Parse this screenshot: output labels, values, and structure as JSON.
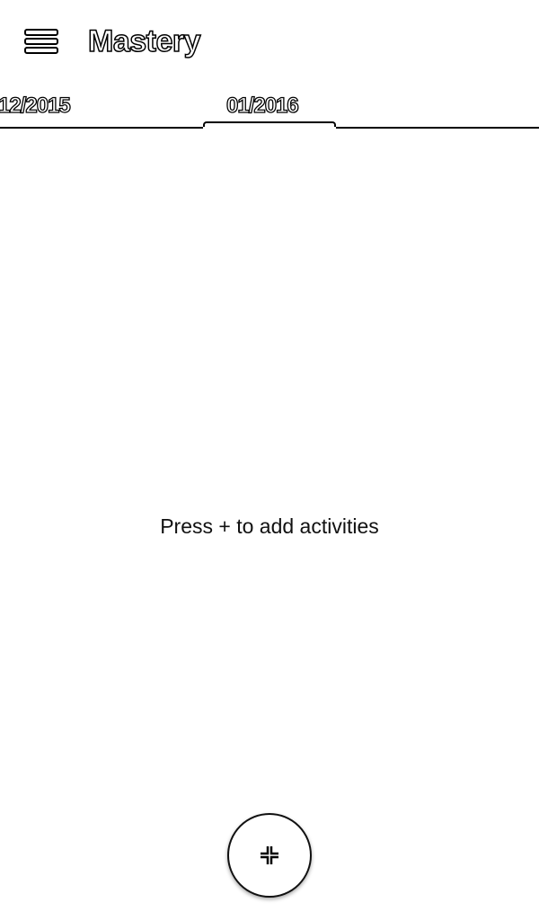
{
  "toolbar": {
    "menu_icon": "hamburger-menu-icon",
    "title": "Mastery"
  },
  "tabs": {
    "items": [
      {
        "label": "12/2015",
        "selected": false
      },
      {
        "label": "01/2016",
        "selected": true
      }
    ]
  },
  "main": {
    "empty_message": "Press + to add activities"
  },
  "fab": {
    "icon": "add-icon"
  },
  "colors": {
    "background": "#ffffff",
    "foreground": "#000000"
  }
}
